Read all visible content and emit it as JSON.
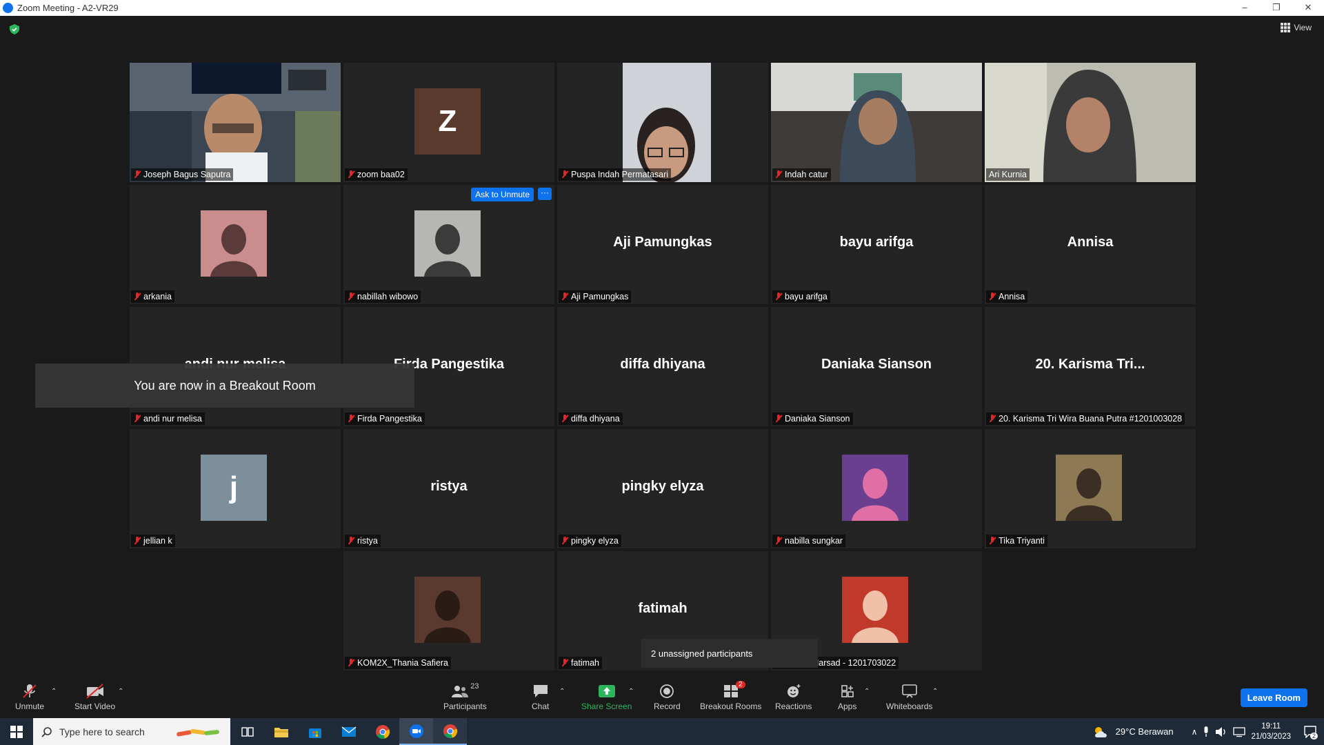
{
  "window": {
    "title": "Zoom Meeting - A2-VR29",
    "controls": [
      "–",
      "❐",
      "✕"
    ]
  },
  "view_label": "View",
  "ask_to_unmute": "Ask to Unmute",
  "more_label": "···",
  "toast": "You are now in a Breakout Room",
  "tooltip": "2 unassigned participants",
  "participants": [
    {
      "name": "Joseph Bagus Saputra",
      "kind": "video"
    },
    {
      "name": "zoom baa02",
      "kind": "letter",
      "letter": "Z",
      "bg": "#5b3a2e"
    },
    {
      "name": "Puspa Indah Permatasari",
      "kind": "video"
    },
    {
      "name": "Indah catur",
      "kind": "video"
    },
    {
      "name": "Ari Kurnia",
      "kind": "video"
    },
    {
      "name": "arkania",
      "kind": "photo"
    },
    {
      "name": "nabillah wibowo",
      "kind": "photo"
    },
    {
      "name": "Aji Pamungkas",
      "kind": "text",
      "display": "Aji Pamungkas"
    },
    {
      "name": "bayu arifga",
      "kind": "text",
      "display": "bayu arifga"
    },
    {
      "name": "Annisa",
      "kind": "text",
      "display": "Annisa"
    },
    {
      "name": "andi nur melisa",
      "kind": "text",
      "display": "andi nur melisa"
    },
    {
      "name": "Firda Pangestika",
      "kind": "text",
      "display": "Firda Pangestika"
    },
    {
      "name": "diffa dhiyana",
      "kind": "text",
      "display": "diffa dhiyana"
    },
    {
      "name": "Daniaka Sianson",
      "kind": "text",
      "display": "Daniaka Sianson"
    },
    {
      "name": "20. Karisma Tri Wira Buana Putra #1201003028",
      "kind": "text",
      "display": "20. Karisma Tri..."
    },
    {
      "name": "jellian k",
      "kind": "letter",
      "letter": "j",
      "bg": "#7d8f9b"
    },
    {
      "name": "ristya",
      "kind": "text",
      "display": "ristya"
    },
    {
      "name": "pingky elyza",
      "kind": "text",
      "display": "pingky elyza"
    },
    {
      "name": "nabilla sungkar",
      "kind": "photo"
    },
    {
      "name": "Tika Triyanti",
      "kind": "photo"
    },
    {
      "name": "",
      "kind": "empty"
    },
    {
      "name": "KOM2X_Thania Safiera",
      "kind": "photo"
    },
    {
      "name": "fatimah",
      "kind": "text",
      "display": "fatimah"
    },
    {
      "name": "Almira Marsad - 1201703022",
      "kind": "photo"
    }
  ],
  "toolbar": {
    "unmute": "Unmute",
    "start_video": "Start Video",
    "participants": "Participants",
    "participants_count": "23",
    "chat": "Chat",
    "share_screen": "Share Screen",
    "record": "Record",
    "breakout_rooms": "Breakout Rooms",
    "breakout_badge": "2",
    "reactions": "Reactions",
    "apps": "Apps",
    "whiteboards": "Whiteboards",
    "leave": "Leave Room"
  },
  "taskbar": {
    "search_placeholder": "Type here to search",
    "weather": "29°C  Berawan",
    "time": "19:11",
    "date": "21/03/2023",
    "notifications": "2"
  },
  "colors": {
    "accent": "#0e72ed",
    "active_speaker": "#d9e353",
    "mute": "#e02828",
    "share_green": "#2db55d"
  }
}
